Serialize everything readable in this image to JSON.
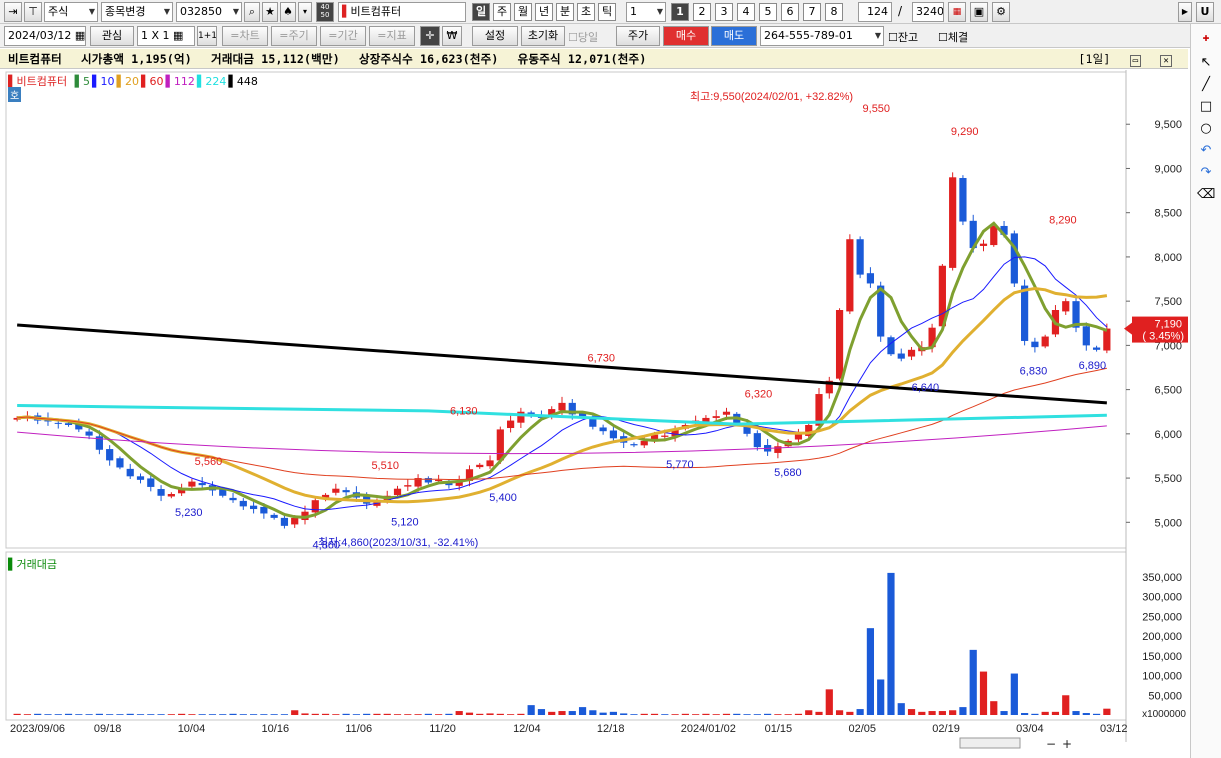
{
  "toolbar": {
    "market": "주식",
    "change_code": "종목변경",
    "code": "032850",
    "name": "비트컴퓨터",
    "periods": [
      "일",
      "주",
      "월",
      "년",
      "분",
      "초",
      "틱"
    ],
    "period_value": "1",
    "num_tabs": [
      "1",
      "2",
      "3",
      "4",
      "5",
      "6",
      "7",
      "8"
    ],
    "count": "124",
    "total": "3240"
  },
  "toolbar2": {
    "date": "2024/03/12",
    "watch": "관심",
    "layout": "1 X 1",
    "layout2": "1+1",
    "overlay": "=차트",
    "cycle": "=주기",
    "range": "=기간",
    "indicator": "=지표",
    "won": "₩",
    "settings": "설정",
    "reset": "초기화",
    "sameday": "당일",
    "price": "주가",
    "buy": "매수",
    "sell": "매도",
    "account": "264-555-789-01",
    "balance": "잔고",
    "fill": "체결"
  },
  "info": {
    "name": "비트컴퓨터",
    "mktcap": "시가총액 1,195(억)",
    "turnover": "거래대금 15,112(백만)",
    "listed": "상장주식수 16,623(천주)",
    "float": "유동주식 12,071(천주)",
    "period_tag": "[1일]"
  },
  "legend": {
    "name": "비트컴퓨터",
    "ma": [
      {
        "label": "5",
        "color": "#2e8b3a"
      },
      {
        "label": "10",
        "color": "#1a1aff"
      },
      {
        "label": "20",
        "color": "#e0a020"
      },
      {
        "label": "60",
        "color": "#e02020"
      },
      {
        "label": "112",
        "color": "#c020c0"
      },
      {
        "label": "224",
        "color": "#20e0e0"
      },
      {
        "label": "448",
        "color": "#000000"
      }
    ],
    "badge": "호",
    "volume": "거래대금"
  },
  "chart_data": {
    "type": "candlestick",
    "price_axis": [
      "9,500",
      "9,000",
      "8,500",
      "8,000",
      "7,500",
      "7,000",
      "6,500",
      "6,000",
      "5,500",
      "5,000"
    ],
    "price_ylim": [
      4800,
      10000
    ],
    "volume_axis": [
      "350,000",
      "300,000",
      "250,000",
      "200,000",
      "150,000",
      "100,000",
      "50,000"
    ],
    "volume_unit": "x1000000",
    "x_labels": [
      "2023/09/06",
      "09/18",
      "10/04",
      "10/16",
      "11/06",
      "11/20",
      "12/04",
      "12/18",
      "2024/01/02",
      "01/15",
      "02/05",
      "02/19",
      "03/04",
      "03/12"
    ],
    "annotations": [
      {
        "text": "최고:9,550(2024/02/01, +32.82%)",
        "color": "#e02020"
      },
      {
        "text": "최저:4,860(2023/10/31, -32.41%)",
        "color": "#1a1acc"
      }
    ],
    "price_labels": [
      "9,550",
      "9,290",
      "8,290",
      "6,730",
      "6,320",
      "6,130",
      "5,560",
      "5,510",
      "5,230",
      "5,120",
      "5,400",
      "5,770",
      "5,680",
      "6,640",
      "6,830",
      "6,890",
      "4,860"
    ],
    "last_price": "7,190",
    "last_change": "( 3.45%)",
    "closes": [
      6180,
      6200,
      6150,
      6140,
      6120,
      6100,
      6050,
      5980,
      5820,
      5700,
      5620,
      5520,
      5480,
      5400,
      5300,
      5320,
      5380,
      5460,
      5420,
      5360,
      5300,
      5250,
      5180,
      5150,
      5100,
      5050,
      4960,
      5050,
      5120,
      5250,
      5310,
      5380,
      5340,
      5280,
      5210,
      5250,
      5300,
      5380,
      5420,
      5500,
      5450,
      5480,
      5420,
      5460,
      5600,
      5650,
      5700,
      6050,
      6150,
      6250,
      6200,
      6180,
      6280,
      6350,
      6220,
      6200,
      6080,
      6030,
      5950,
      5900,
      5870,
      5920,
      5990,
      5980,
      6050,
      6100,
      6150,
      6180,
      6200,
      6250,
      6120,
      6000,
      5850,
      5800,
      5860,
      5920,
      6000,
      6100,
      6450,
      6600,
      7400,
      8200,
      7800,
      7700,
      7100,
      6900,
      6850,
      6950,
      6980,
      7200,
      7900,
      8900,
      8400,
      8100,
      8150,
      8350,
      8250,
      7700,
      7050,
      6980,
      7100,
      7400,
      7500,
      7200,
      7000,
      6950,
      7190
    ],
    "volumes": [
      3,
      2,
      3,
      2,
      2,
      3,
      2,
      2,
      3,
      2,
      2,
      3,
      2,
      2,
      2,
      2,
      3,
      2,
      2,
      2,
      2,
      3,
      2,
      2,
      2,
      2,
      2,
      12,
      4,
      3,
      3,
      2,
      3,
      2,
      3,
      3,
      3,
      2,
      2,
      2,
      3,
      2,
      3,
      10,
      6,
      3,
      4,
      3,
      2,
      3,
      25,
      15,
      8,
      10,
      10,
      20,
      12,
      6,
      8,
      4,
      2,
      3,
      3,
      2,
      2,
      3,
      2,
      3,
      2,
      3,
      3,
      2,
      2,
      3,
      2,
      2,
      3,
      12,
      8,
      65,
      12,
      8,
      15,
      220,
      90,
      360,
      30,
      15,
      8,
      10,
      10,
      12,
      20,
      165,
      110,
      35,
      10,
      105,
      5,
      3,
      8,
      8,
      50,
      10,
      5,
      3,
      16
    ]
  },
  "bottom": {
    "zoom_out": "−",
    "zoom_in": "+"
  }
}
